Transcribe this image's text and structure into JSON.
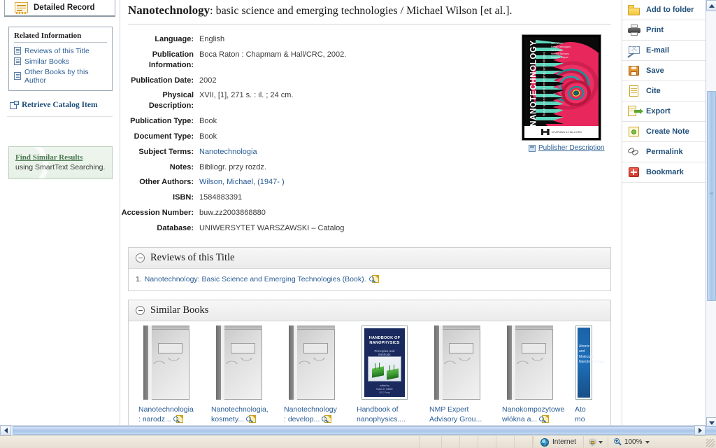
{
  "left_panel": {
    "tab": {
      "label": "Detailed Record",
      "icon": "record-icon"
    },
    "related": {
      "title": "Related Information",
      "items": [
        {
          "label": "Reviews of this Title",
          "icon": "document-icon"
        },
        {
          "label": "Similar Books",
          "icon": "document-icon"
        },
        {
          "label": "Other Books by this Author",
          "icon": "document-icon"
        }
      ]
    },
    "retrieve": {
      "label": "Retrieve Catalog Item",
      "icon": "external-window-icon"
    },
    "smarttext": {
      "link": "Find Similar Results",
      "sub": "using SmartText Searching."
    }
  },
  "record": {
    "title_main": "Nanotechnology",
    "title_rest": ": basic science and emerging technologies / Michael Wilson [et al.].",
    "fields": [
      {
        "label": "Language:",
        "value": "English",
        "link": false
      },
      {
        "label": "Publication Information:",
        "value": "Boca Raton : Chapmam & Hall/CRC, 2002.",
        "link": false
      },
      {
        "label": "Publication Date:",
        "value": "2002",
        "link": false
      },
      {
        "label": "Physical Description:",
        "value": "XVII, [1], 271 s. : il. ; 24 cm.",
        "link": false
      },
      {
        "label": "Publication Type:",
        "value": "Book",
        "link": false
      },
      {
        "label": "Document Type:",
        "value": "Book",
        "link": false
      },
      {
        "label": "Subject Terms:",
        "value": "Nanotechnologia",
        "link": true
      },
      {
        "label": "Notes:",
        "value": "Bibliogr. przy rozdz.",
        "link": false
      },
      {
        "label": "Other Authors:",
        "value": "Wilson, Michael, (1947- )",
        "link": true
      },
      {
        "label": "ISBN:",
        "value": "1584883391",
        "link": false
      },
      {
        "label": "Accession Number:",
        "value": "buw.zz2003868880",
        "link": false
      },
      {
        "label": "Database:",
        "value": "UNIWERSYTET WARSZAWSKI – Catalog",
        "link": false
      }
    ],
    "cover": {
      "title": "NANOTECHNOLOGY",
      "subtitle": "basic science and emerging technologies",
      "authors": "Mick Wilson\nKamali Kannangara\nGeoff Smith\nMichelle Simmons\nBurkhard Raguse",
      "publisher": "CHAPMAN & HALL/CRC"
    },
    "publisher_description_link": "Publisher Description"
  },
  "sections": {
    "reviews": {
      "title": "Reviews of this Title",
      "items": [
        {
          "num": "1.",
          "text": "Nanotechnology: Basic Science and Emerging Technologies (Book)."
        }
      ]
    },
    "similar": {
      "title": "Similar Books",
      "books": [
        {
          "title": "Nanotechnologia : narodz...",
          "cover": "generic",
          "has_mag": true
        },
        {
          "title": "Nanotechnologia, kosmety...",
          "cover": "generic",
          "has_mag": true
        },
        {
          "title": "Nanotechnology : develop...",
          "cover": "generic",
          "has_mag": true
        },
        {
          "title": "Handbook of nanophysics....",
          "cover": "nanophysics",
          "has_mag": true,
          "cover_title": "HANDBOOK OF NANOPHYSICS",
          "cover_sub": "Principles and Methods",
          "cover_editor": "edited by\nKlaus D. Sattler",
          "cover_pub": "CRC Press"
        },
        {
          "title": "NMP Expert Advisory Grou...",
          "cover": "generic",
          "has_mag": true
        },
        {
          "title": "Nanokompozytowe włókna a...",
          "cover": "generic",
          "has_mag": true
        },
        {
          "title": "Ato mo",
          "cover": "blue",
          "has_mag": true,
          "cover_title": "Atomic and\nMolecular\nNanotechnology"
        }
      ]
    }
  },
  "tools": {
    "items": [
      {
        "label": "Add to folder",
        "icon": "folder-icon"
      },
      {
        "label": "Print",
        "icon": "printer-icon"
      },
      {
        "label": "E-mail",
        "icon": "envelope-icon"
      },
      {
        "label": "Save",
        "icon": "floppy-disk-icon"
      },
      {
        "label": "Cite",
        "icon": "page-icon"
      },
      {
        "label": "Export",
        "icon": "export-arrow-icon"
      },
      {
        "label": "Create Note",
        "icon": "note-icon"
      },
      {
        "label": "Permalink",
        "icon": "chain-link-icon"
      },
      {
        "label": "Bookmark",
        "icon": "bookmark-plus-icon"
      }
    ]
  },
  "statusbar": {
    "zone": "Internet",
    "zoom": "100%"
  },
  "colors": {
    "link": "#2a5d94",
    "tool_link": "#1f4e79",
    "smarttext": "#4b7a52"
  }
}
